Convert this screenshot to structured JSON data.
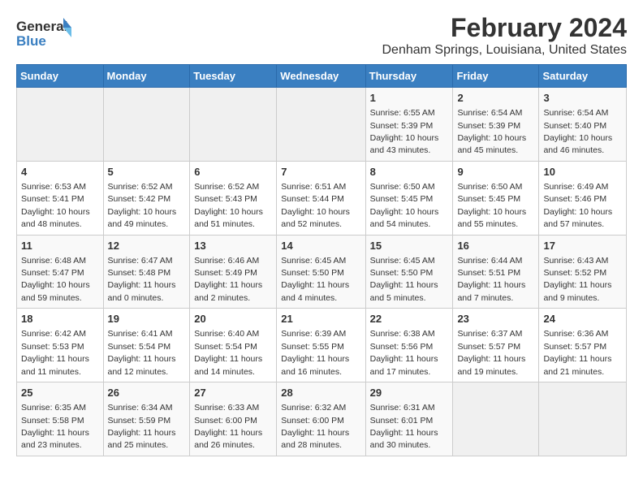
{
  "logo": {
    "line1": "General",
    "line2": "Blue"
  },
  "title": "February 2024",
  "subtitle": "Denham Springs, Louisiana, United States",
  "days_of_week": [
    "Sunday",
    "Monday",
    "Tuesday",
    "Wednesday",
    "Thursday",
    "Friday",
    "Saturday"
  ],
  "weeks": [
    [
      {
        "day": "",
        "info": ""
      },
      {
        "day": "",
        "info": ""
      },
      {
        "day": "",
        "info": ""
      },
      {
        "day": "",
        "info": ""
      },
      {
        "day": "1",
        "info": "Sunrise: 6:55 AM\nSunset: 5:39 PM\nDaylight: 10 hours and 43 minutes."
      },
      {
        "day": "2",
        "info": "Sunrise: 6:54 AM\nSunset: 5:39 PM\nDaylight: 10 hours and 45 minutes."
      },
      {
        "day": "3",
        "info": "Sunrise: 6:54 AM\nSunset: 5:40 PM\nDaylight: 10 hours and 46 minutes."
      }
    ],
    [
      {
        "day": "4",
        "info": "Sunrise: 6:53 AM\nSunset: 5:41 PM\nDaylight: 10 hours and 48 minutes."
      },
      {
        "day": "5",
        "info": "Sunrise: 6:52 AM\nSunset: 5:42 PM\nDaylight: 10 hours and 49 minutes."
      },
      {
        "day": "6",
        "info": "Sunrise: 6:52 AM\nSunset: 5:43 PM\nDaylight: 10 hours and 51 minutes."
      },
      {
        "day": "7",
        "info": "Sunrise: 6:51 AM\nSunset: 5:44 PM\nDaylight: 10 hours and 52 minutes."
      },
      {
        "day": "8",
        "info": "Sunrise: 6:50 AM\nSunset: 5:45 PM\nDaylight: 10 hours and 54 minutes."
      },
      {
        "day": "9",
        "info": "Sunrise: 6:50 AM\nSunset: 5:45 PM\nDaylight: 10 hours and 55 minutes."
      },
      {
        "day": "10",
        "info": "Sunrise: 6:49 AM\nSunset: 5:46 PM\nDaylight: 10 hours and 57 minutes."
      }
    ],
    [
      {
        "day": "11",
        "info": "Sunrise: 6:48 AM\nSunset: 5:47 PM\nDaylight: 10 hours and 59 minutes."
      },
      {
        "day": "12",
        "info": "Sunrise: 6:47 AM\nSunset: 5:48 PM\nDaylight: 11 hours and 0 minutes."
      },
      {
        "day": "13",
        "info": "Sunrise: 6:46 AM\nSunset: 5:49 PM\nDaylight: 11 hours and 2 minutes."
      },
      {
        "day": "14",
        "info": "Sunrise: 6:45 AM\nSunset: 5:50 PM\nDaylight: 11 hours and 4 minutes."
      },
      {
        "day": "15",
        "info": "Sunrise: 6:45 AM\nSunset: 5:50 PM\nDaylight: 11 hours and 5 minutes."
      },
      {
        "day": "16",
        "info": "Sunrise: 6:44 AM\nSunset: 5:51 PM\nDaylight: 11 hours and 7 minutes."
      },
      {
        "day": "17",
        "info": "Sunrise: 6:43 AM\nSunset: 5:52 PM\nDaylight: 11 hours and 9 minutes."
      }
    ],
    [
      {
        "day": "18",
        "info": "Sunrise: 6:42 AM\nSunset: 5:53 PM\nDaylight: 11 hours and 11 minutes."
      },
      {
        "day": "19",
        "info": "Sunrise: 6:41 AM\nSunset: 5:54 PM\nDaylight: 11 hours and 12 minutes."
      },
      {
        "day": "20",
        "info": "Sunrise: 6:40 AM\nSunset: 5:54 PM\nDaylight: 11 hours and 14 minutes."
      },
      {
        "day": "21",
        "info": "Sunrise: 6:39 AM\nSunset: 5:55 PM\nDaylight: 11 hours and 16 minutes."
      },
      {
        "day": "22",
        "info": "Sunrise: 6:38 AM\nSunset: 5:56 PM\nDaylight: 11 hours and 17 minutes."
      },
      {
        "day": "23",
        "info": "Sunrise: 6:37 AM\nSunset: 5:57 PM\nDaylight: 11 hours and 19 minutes."
      },
      {
        "day": "24",
        "info": "Sunrise: 6:36 AM\nSunset: 5:57 PM\nDaylight: 11 hours and 21 minutes."
      }
    ],
    [
      {
        "day": "25",
        "info": "Sunrise: 6:35 AM\nSunset: 5:58 PM\nDaylight: 11 hours and 23 minutes."
      },
      {
        "day": "26",
        "info": "Sunrise: 6:34 AM\nSunset: 5:59 PM\nDaylight: 11 hours and 25 minutes."
      },
      {
        "day": "27",
        "info": "Sunrise: 6:33 AM\nSunset: 6:00 PM\nDaylight: 11 hours and 26 minutes."
      },
      {
        "day": "28",
        "info": "Sunrise: 6:32 AM\nSunset: 6:00 PM\nDaylight: 11 hours and 28 minutes."
      },
      {
        "day": "29",
        "info": "Sunrise: 6:31 AM\nSunset: 6:01 PM\nDaylight: 11 hours and 30 minutes."
      },
      {
        "day": "",
        "info": ""
      },
      {
        "day": "",
        "info": ""
      }
    ]
  ]
}
